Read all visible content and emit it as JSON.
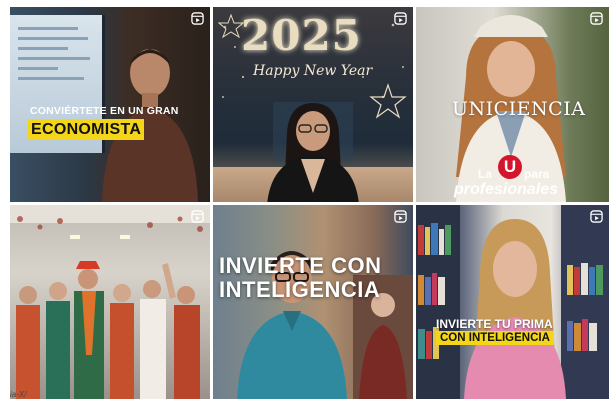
{
  "tiles": [
    {
      "id": "t1",
      "caption_line1": "CONVIÉRTETE EN UN GRAN",
      "caption_line2": "ECONOMISTA",
      "icon": "reels-icon"
    },
    {
      "id": "t2",
      "year": "2025",
      "greeting": "Happy New Year",
      "icon": "reels-icon"
    },
    {
      "id": "t3",
      "brand": "UNICIENCIA",
      "slogan_la": "La",
      "logo_letter": "U",
      "slogan_para": "para",
      "slogan_profesionales": "profesionales",
      "icon": "reels-icon"
    },
    {
      "id": "t4",
      "watermark": "ia-X/",
      "icon": "reels-icon"
    },
    {
      "id": "t5",
      "caption_line1": "INVIERTE CON",
      "caption_line2": "INTELIGENCIA",
      "icon": "reels-icon"
    },
    {
      "id": "t6",
      "caption_line1": "INVIERTE TU PRIMA",
      "caption_line2": "CON INTELIGENCIA",
      "icon": "reels-icon"
    }
  ],
  "colors": {
    "highlight_yellow": "#f3d51a",
    "brand_red": "#d5152b",
    "text_white": "#ffffff"
  }
}
